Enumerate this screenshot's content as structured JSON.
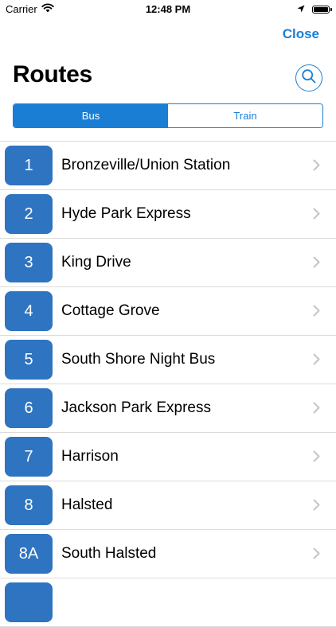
{
  "status_bar": {
    "carrier": "Carrier",
    "time": "12:48 PM"
  },
  "nav": {
    "close_label": "Close",
    "title": "Routes"
  },
  "segments": [
    {
      "label": "Bus",
      "selected": true
    },
    {
      "label": "Train",
      "selected": false
    }
  ],
  "routes": [
    {
      "number": "1",
      "name": "Bronzeville/Union Station"
    },
    {
      "number": "2",
      "name": "Hyde Park Express"
    },
    {
      "number": "3",
      "name": "King Drive"
    },
    {
      "number": "4",
      "name": "Cottage Grove"
    },
    {
      "number": "5",
      "name": "South Shore Night Bus"
    },
    {
      "number": "6",
      "name": "Jackson Park Express"
    },
    {
      "number": "7",
      "name": "Harrison"
    },
    {
      "number": "8",
      "name": "Halsted"
    },
    {
      "number": "8A",
      "name": "South Halsted"
    },
    {
      "number": "",
      "name": ""
    }
  ],
  "colors": {
    "accent": "#1a7fd4",
    "route_badge": "#2f74c0"
  },
  "icons": {
    "wifi": "wifi-icon",
    "location": "location-arrow-icon",
    "battery": "battery-icon",
    "search": "search-icon",
    "chevron": "chevron-right-icon"
  }
}
